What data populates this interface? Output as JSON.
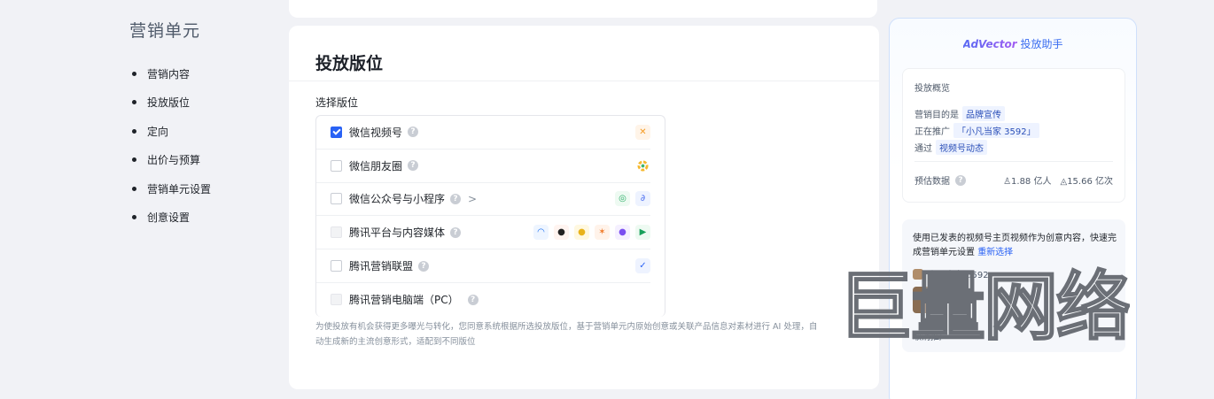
{
  "left_nav": {
    "title": "营销单元",
    "items": [
      {
        "label": "营销内容"
      },
      {
        "label": "投放版位"
      },
      {
        "label": "定向"
      },
      {
        "label": "出价与预算"
      },
      {
        "label": "营销单元设置"
      },
      {
        "label": "创意设置"
      }
    ]
  },
  "main": {
    "title": "投放版位",
    "section_label": "选择版位",
    "placements": [
      {
        "label": "微信视频号",
        "checked": true,
        "disabled": false
      },
      {
        "label": "微信朋友圈",
        "checked": false,
        "disabled": false
      },
      {
        "label": "微信公众号与小程序",
        "checked": false,
        "disabled": false,
        "chevron": ">"
      },
      {
        "label": "腾讯平台与内容媒体",
        "checked": false,
        "disabled": true
      },
      {
        "label": "腾讯营销联盟",
        "checked": false,
        "disabled": false
      },
      {
        "label": "腾讯营销电脑端（PC）",
        "checked": false,
        "disabled": true
      }
    ],
    "help_glyph": "?",
    "footnote_line1": "为使投放有机会获得更多曝光与转化，您同意系统根据所选投放版位，基于营销单元内原始创意或关联产品信息对素材进行 AI 处理，自",
    "footnote_line2": "动生成新的主流创意形式，适配到不同版位"
  },
  "assistant": {
    "title_brand": "AdVector",
    "title_suffix": " 投放助手",
    "overview": {
      "title": "投放概览",
      "goal_label": "营销目的是",
      "goal_value": "品牌宣传",
      "promoting_label": "正在推广",
      "promoting_value": "「小凡当家 3592」",
      "via_label": "通过",
      "via_value": "视频号动态",
      "estimate_label": "预估数据",
      "estimate_users": "1.88 亿人",
      "estimate_views": "15.66 亿次"
    },
    "tip": {
      "text": "使用已发表的视频号主页视频作为创意内容，快速完成营销单元设置",
      "link": "重新选择",
      "channel_name": "小凡当家 3592",
      "cancel": "取消推广"
    }
  },
  "watermark_text": "巨量网络",
  "colors": {
    "accent": "#2962f5",
    "background": "#f1f2f6"
  }
}
